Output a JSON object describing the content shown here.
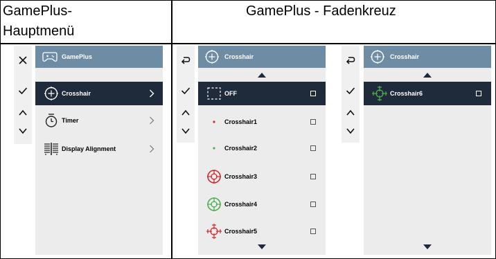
{
  "header": {
    "col1_line1": "GamePlus-",
    "col1_line2": "Hauptmenü",
    "col2": "GamePlus - Fadenkreuz"
  },
  "main_menu": {
    "title": "GamePlus",
    "items": [
      {
        "label": "Crosshair",
        "icon": "crosshair-icon",
        "selected": true
      },
      {
        "label": "Timer",
        "icon": "timer-icon",
        "selected": false
      },
      {
        "label": "Display Alignment",
        "icon": "display-alignment-icon",
        "selected": false
      }
    ]
  },
  "crosshair_menu": {
    "title": "Crosshair",
    "items": [
      {
        "label": "OFF",
        "icon": "off-dashed-box-icon",
        "selected": true
      },
      {
        "label": "Crosshair1",
        "icon": "red-dot-icon",
        "selected": false
      },
      {
        "label": "Crosshair2",
        "icon": "green-dot-icon",
        "selected": false
      },
      {
        "label": "Crosshair3",
        "icon": "red-crosshair-icon",
        "selected": false
      },
      {
        "label": "Crosshair4",
        "icon": "green-crosshair-icon",
        "selected": false
      },
      {
        "label": "Crosshair5",
        "icon": "red-tick-crosshair-icon",
        "selected": false
      }
    ]
  },
  "crosshair_menu_scrolled": {
    "title": "Crosshair",
    "items": [
      {
        "label": "Crosshair6",
        "icon": "green-tick-crosshair-icon",
        "selected": true
      }
    ]
  },
  "colors": {
    "header_bg": "#6e8ca4",
    "selected_bg": "#1f2b3a",
    "panel_bg": "#ececec",
    "strip_bg": "#f0f0f0",
    "red": "#d9262b",
    "green": "#4cb04b"
  }
}
